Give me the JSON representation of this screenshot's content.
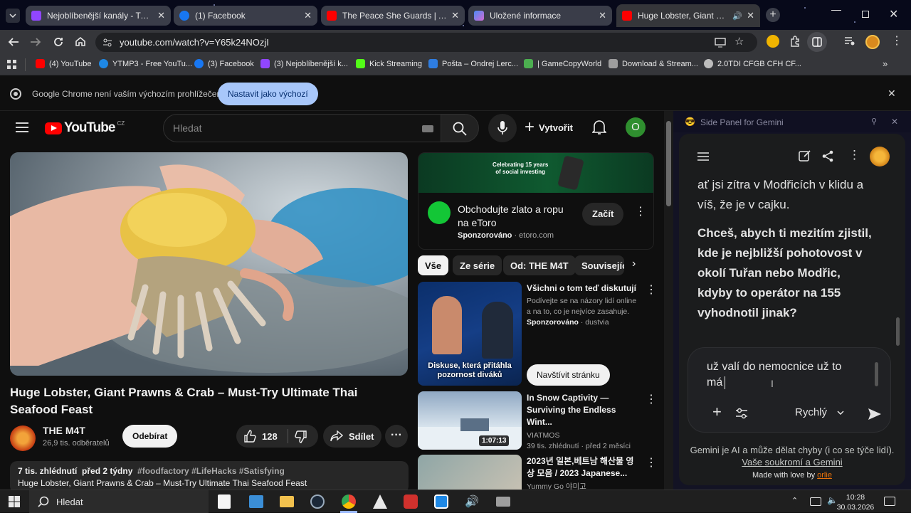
{
  "tabs": [
    {
      "title": "Nejoblíbenější kanály - Twitch",
      "icon": "twitch-icon",
      "color": "#9146ff"
    },
    {
      "title": "(1) Facebook",
      "icon": "facebook-icon",
      "color": "#1877f2"
    },
    {
      "title": "The Peace She Guards | Ambien",
      "icon": "youtube-icon",
      "color": "#ff0000"
    },
    {
      "title": "Uložené informace",
      "icon": "gemini-icon",
      "color": "#4a8af4"
    },
    {
      "title": "Huge Lobster, Giant Prawns",
      "icon": "youtube-icon",
      "color": "#ff0000"
    }
  ],
  "address": {
    "url": "youtube.com/watch?v=Y65k24NOzjI"
  },
  "bookmarks": [
    {
      "label": "(4) YouTube",
      "color": "#ff0000"
    },
    {
      "label": "YTMP3 - Free YouTu...",
      "color": "#1e88e5"
    },
    {
      "label": "(3) Facebook",
      "color": "#1877f2"
    },
    {
      "label": "(3) Nejoblíbenější k...",
      "color": "#9146ff"
    },
    {
      "label": "Kick Streaming",
      "color": "#53fc18"
    },
    {
      "label": "Pošta – Ondrej Lerc...",
      "color": "#2e7de1"
    },
    {
      "label": "| GameCopyWorld",
      "color": "#4caf50"
    },
    {
      "label": "Download & Stream...",
      "color": "#9e9e9e"
    },
    {
      "label": "2.0TDI CFGB CFH CF...",
      "color": "#bdbdbd"
    }
  ],
  "infobar": {
    "text": "Google Chrome není vaším výchozím prohlížečem",
    "button": "Nastavit jako výchozí"
  },
  "youtube": {
    "logo": "YouTube",
    "region": "CZ",
    "search_placeholder": "Hledat",
    "create": "Vytvořit",
    "avatar_letter": "O",
    "video_title": "Huge Lobster, Giant Prawns & Crab – Must-Try Ultimate Thai Seafood Feast",
    "channel": "THE M4T",
    "subscribers": "26,9 tis. odběratelů",
    "subscribe": "Odebírat",
    "likes": "128",
    "share": "Sdílet",
    "views": "7 tis. zhlédnutí",
    "age": "před 2 týdny",
    "hashtags": "#foodfactory #LifeHacks #Satisfying",
    "description_line": "Huge Lobster, Giant Prawns & Crab – Must-Try Ultimate Thai Seafood Feast"
  },
  "ad": {
    "banner_line1": "Celebrating 15 years",
    "banner_line2": "of social investing",
    "title": "Obchodujte zlato a ropu na eToro",
    "sponsored": "Sponzorováno",
    "domain": "etoro.com",
    "cta": "Začít"
  },
  "chips": [
    "Vše",
    "Ze série",
    "Od: THE M4T",
    "Souvisejíc"
  ],
  "recommended": [
    {
      "title": "Všichni o tom teď diskutují",
      "desc": "Podívejte se na názory lidí online a na to, co je nejvíce zasahuje.",
      "sponsored": "Sponzorováno",
      "source": "dustvia",
      "thumb_caption": "Diskuse, která přitáhla pozornost diváků",
      "cta": "Navštívit stránku"
    },
    {
      "title": "In Snow Captivity — Surviving the Endless Wint...",
      "channel": "VIATMOS",
      "views": "39 tis. zhlédnutí",
      "age": "před 2 měsíci",
      "duration": "1:07:13"
    },
    {
      "title": "2023년 일본,베트남 해산물 영상 모음 / 2023 Japanese...",
      "channel": "Yummy Go 야미고"
    }
  ],
  "gemini": {
    "panel_title": "Side Panel for Gemini",
    "message_line1": "ať jsi zítra v Modřicích v klidu a",
    "message_line2": "víš, že je v cajku.",
    "question_lines": [
      "Chceš, abych ti mezitím zjistil,",
      "kde je nejbližší pohotovost v",
      "okolí Tuřan nebo Modřic,",
      "kdyby to operátor na 155",
      "vyhodnotil jinak?"
    ],
    "input_line1": "už valí do nemocnice už to",
    "input_line2": "má",
    "mode": "Rychlý",
    "disclaimer": "Gemini je AI a může dělat chyby (i co se týče lidí).",
    "privacy_link": "Vaše soukromí a Gemini",
    "made_with": "Made with love by",
    "author": "orlie"
  },
  "taskbar": {
    "search": "Hledat",
    "time": "10:28",
    "date": "30.03.2026"
  }
}
